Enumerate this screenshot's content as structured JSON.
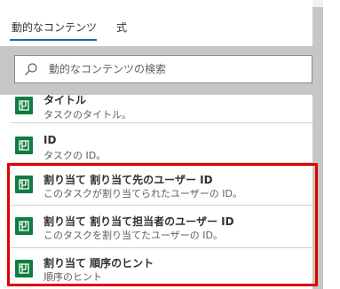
{
  "tabs": [
    {
      "label": "動的なコンテンツ",
      "active": true
    },
    {
      "label": "式",
      "active": false
    }
  ],
  "search": {
    "placeholder": "動的なコンテンツの検索",
    "value": ""
  },
  "items": [
    {
      "title": "タイトル",
      "description": "タスクのタイトル。",
      "icon": "planner-icon"
    },
    {
      "title": "ID",
      "description": "タスクの ID。",
      "icon": "planner-icon"
    },
    {
      "title": "割り当て 割り当て先のユーザー ID",
      "description": "このタスクが割り当てられたユーザーの ID。",
      "icon": "planner-icon"
    },
    {
      "title": "割り当て 割り当て担当者のユーザー ID",
      "description": "このタスクを割り当てたユーザーの ID。",
      "icon": "planner-icon"
    },
    {
      "title": "割り当て 順序のヒント",
      "description": "順序のヒント",
      "icon": "planner-icon"
    }
  ],
  "colors": {
    "accent": "#0f6cbd",
    "icon_bg": "#107c41",
    "highlight": "#e00000"
  }
}
